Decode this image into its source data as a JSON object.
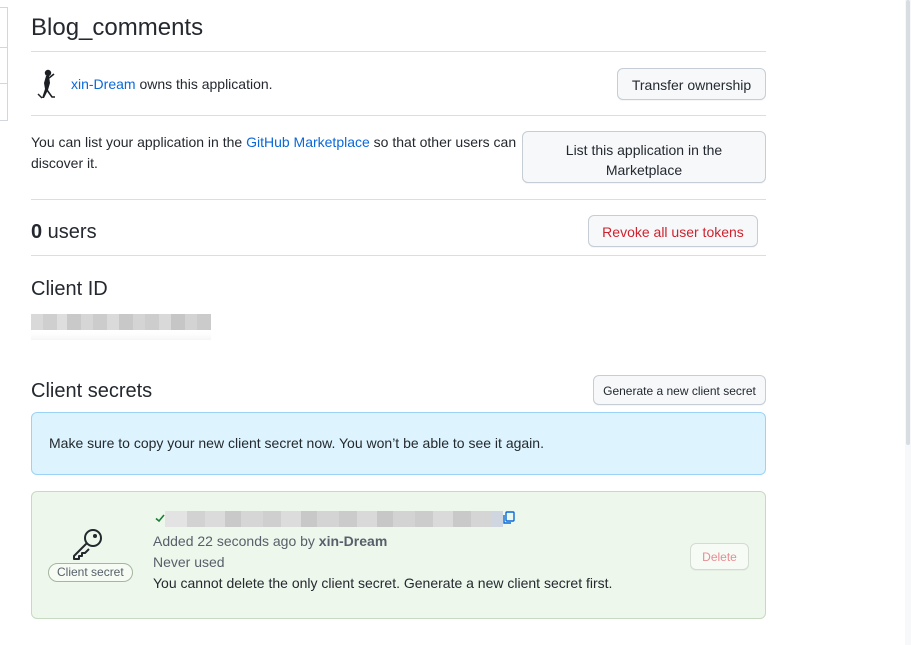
{
  "app": {
    "title": "Blog_comments"
  },
  "owner": {
    "username": "xin-Dream",
    "suffix": " owns this application.",
    "transfer_label": "Transfer ownership"
  },
  "marketplace": {
    "text_before": "You can list your application in the ",
    "link_text": "GitHub Marketplace",
    "text_after": " so that other users can discover it.",
    "button_label": "List this application in the Marketplace"
  },
  "users": {
    "count": "0",
    "label": " users",
    "revoke_label": "Revoke all user tokens"
  },
  "client_id": {
    "title": "Client ID"
  },
  "secrets": {
    "title": "Client secrets",
    "generate_label": "Generate a new client secret",
    "flash_message": "Make sure to copy your new client secret now. You won’t be able to see it again.",
    "item": {
      "label": "Client secret",
      "added_prefix": "Added 22 seconds ago by ",
      "added_by": "xin-Dream",
      "usage": "Never used",
      "note": "You cannot delete the only client secret. Generate a new client secret first.",
      "delete_label": "Delete"
    }
  },
  "icons": {
    "key": "key-icon",
    "check": "check-icon",
    "copy": "copy-icon"
  },
  "colors": {
    "link": "#0969da",
    "danger": "#cf222e",
    "flash_bg": "#ddf4ff",
    "secret_bg": "#eef7ec"
  }
}
